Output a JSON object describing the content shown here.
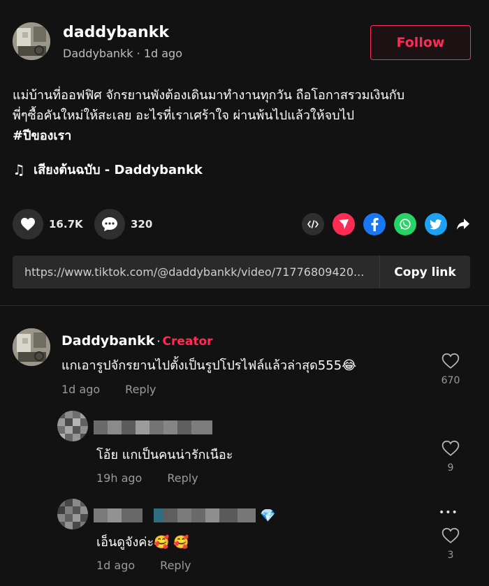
{
  "post": {
    "username": "daddybankk",
    "display_name": "Daddybankk",
    "time": "1d ago",
    "follow_label": "Follow",
    "caption_line1": "แม่บ้านที่ออฟฟิศ จักรยานพังต้องเดินมาทำงานทุกวัน ถือโอกาสรวมเงินกับ",
    "caption_line2": "พี่ๆซื้อคันใหม่ให้สะเลย อะไรที่เราเศร้าใจ ผ่านพ้นไปแล้วให้จบไป",
    "hashtag": "#ปีของเรา",
    "music_icon": "♫",
    "music": "เสียงต้นฉบับ - Daddybankk"
  },
  "actions": {
    "likes": "16.7K",
    "comments": "320"
  },
  "share": {
    "icons": [
      "embed-icon",
      "send-icon",
      "facebook-icon",
      "whatsapp-icon",
      "twitter-icon",
      "share-arrow-icon"
    ],
    "colors": {
      "send": "#fe2c55",
      "facebook": "#1877f2",
      "whatsapp": "#25d366",
      "twitter": "#1da1f2",
      "embed": "#2f2f2f"
    }
  },
  "link": {
    "url": "https://www.tiktok.com/@daddybankk/video/71776809420...",
    "copy_label": "Copy link"
  },
  "comments": [
    {
      "name": "Daddybankk",
      "dot": "·",
      "badge": "Creator",
      "text": "แกเอารูปจักรยานไปตั้งเป็นรูปโปรไฟล์แล้วล่าสุด555😂",
      "time": "1d ago",
      "reply_label": "Reply",
      "likes": "670"
    },
    {
      "text": "โอ้ย แกเป็นคนน่ารักเนือะ",
      "time": "19h ago",
      "reply_label": "Reply",
      "likes": "9"
    },
    {
      "name_emoji": "💎",
      "text": "เอ็นดูจังค่ะ🥰 🥰",
      "time": "1d ago",
      "reply_label": "Reply",
      "likes": "3",
      "more": "•••"
    }
  ],
  "colors": {
    "accent": "#fe2c55",
    "background": "#121212",
    "muted": "#9a9a9a"
  }
}
